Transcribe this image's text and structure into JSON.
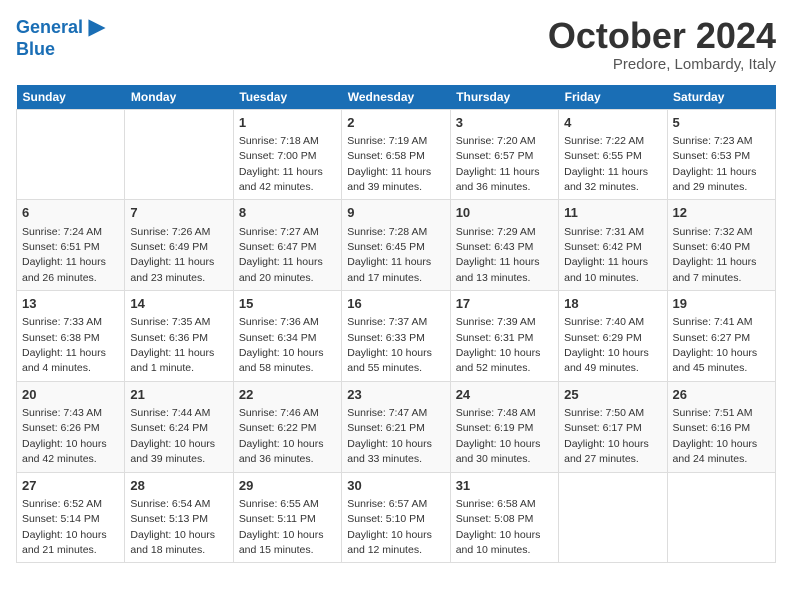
{
  "header": {
    "logo_line1": "General",
    "logo_line2": "Blue",
    "month": "October 2024",
    "location": "Predore, Lombardy, Italy"
  },
  "weekdays": [
    "Sunday",
    "Monday",
    "Tuesday",
    "Wednesday",
    "Thursday",
    "Friday",
    "Saturday"
  ],
  "weeks": [
    [
      {
        "day": "",
        "sunrise": "",
        "sunset": "",
        "daylight": ""
      },
      {
        "day": "",
        "sunrise": "",
        "sunset": "",
        "daylight": ""
      },
      {
        "day": "1",
        "sunrise": "Sunrise: 7:18 AM",
        "sunset": "Sunset: 7:00 PM",
        "daylight": "Daylight: 11 hours and 42 minutes."
      },
      {
        "day": "2",
        "sunrise": "Sunrise: 7:19 AM",
        "sunset": "Sunset: 6:58 PM",
        "daylight": "Daylight: 11 hours and 39 minutes."
      },
      {
        "day": "3",
        "sunrise": "Sunrise: 7:20 AM",
        "sunset": "Sunset: 6:57 PM",
        "daylight": "Daylight: 11 hours and 36 minutes."
      },
      {
        "day": "4",
        "sunrise": "Sunrise: 7:22 AM",
        "sunset": "Sunset: 6:55 PM",
        "daylight": "Daylight: 11 hours and 32 minutes."
      },
      {
        "day": "5",
        "sunrise": "Sunrise: 7:23 AM",
        "sunset": "Sunset: 6:53 PM",
        "daylight": "Daylight: 11 hours and 29 minutes."
      }
    ],
    [
      {
        "day": "6",
        "sunrise": "Sunrise: 7:24 AM",
        "sunset": "Sunset: 6:51 PM",
        "daylight": "Daylight: 11 hours and 26 minutes."
      },
      {
        "day": "7",
        "sunrise": "Sunrise: 7:26 AM",
        "sunset": "Sunset: 6:49 PM",
        "daylight": "Daylight: 11 hours and 23 minutes."
      },
      {
        "day": "8",
        "sunrise": "Sunrise: 7:27 AM",
        "sunset": "Sunset: 6:47 PM",
        "daylight": "Daylight: 11 hours and 20 minutes."
      },
      {
        "day": "9",
        "sunrise": "Sunrise: 7:28 AM",
        "sunset": "Sunset: 6:45 PM",
        "daylight": "Daylight: 11 hours and 17 minutes."
      },
      {
        "day": "10",
        "sunrise": "Sunrise: 7:29 AM",
        "sunset": "Sunset: 6:43 PM",
        "daylight": "Daylight: 11 hours and 13 minutes."
      },
      {
        "day": "11",
        "sunrise": "Sunrise: 7:31 AM",
        "sunset": "Sunset: 6:42 PM",
        "daylight": "Daylight: 11 hours and 10 minutes."
      },
      {
        "day": "12",
        "sunrise": "Sunrise: 7:32 AM",
        "sunset": "Sunset: 6:40 PM",
        "daylight": "Daylight: 11 hours and 7 minutes."
      }
    ],
    [
      {
        "day": "13",
        "sunrise": "Sunrise: 7:33 AM",
        "sunset": "Sunset: 6:38 PM",
        "daylight": "Daylight: 11 hours and 4 minutes."
      },
      {
        "day": "14",
        "sunrise": "Sunrise: 7:35 AM",
        "sunset": "Sunset: 6:36 PM",
        "daylight": "Daylight: 11 hours and 1 minute."
      },
      {
        "day": "15",
        "sunrise": "Sunrise: 7:36 AM",
        "sunset": "Sunset: 6:34 PM",
        "daylight": "Daylight: 10 hours and 58 minutes."
      },
      {
        "day": "16",
        "sunrise": "Sunrise: 7:37 AM",
        "sunset": "Sunset: 6:33 PM",
        "daylight": "Daylight: 10 hours and 55 minutes."
      },
      {
        "day": "17",
        "sunrise": "Sunrise: 7:39 AM",
        "sunset": "Sunset: 6:31 PM",
        "daylight": "Daylight: 10 hours and 52 minutes."
      },
      {
        "day": "18",
        "sunrise": "Sunrise: 7:40 AM",
        "sunset": "Sunset: 6:29 PM",
        "daylight": "Daylight: 10 hours and 49 minutes."
      },
      {
        "day": "19",
        "sunrise": "Sunrise: 7:41 AM",
        "sunset": "Sunset: 6:27 PM",
        "daylight": "Daylight: 10 hours and 45 minutes."
      }
    ],
    [
      {
        "day": "20",
        "sunrise": "Sunrise: 7:43 AM",
        "sunset": "Sunset: 6:26 PM",
        "daylight": "Daylight: 10 hours and 42 minutes."
      },
      {
        "day": "21",
        "sunrise": "Sunrise: 7:44 AM",
        "sunset": "Sunset: 6:24 PM",
        "daylight": "Daylight: 10 hours and 39 minutes."
      },
      {
        "day": "22",
        "sunrise": "Sunrise: 7:46 AM",
        "sunset": "Sunset: 6:22 PM",
        "daylight": "Daylight: 10 hours and 36 minutes."
      },
      {
        "day": "23",
        "sunrise": "Sunrise: 7:47 AM",
        "sunset": "Sunset: 6:21 PM",
        "daylight": "Daylight: 10 hours and 33 minutes."
      },
      {
        "day": "24",
        "sunrise": "Sunrise: 7:48 AM",
        "sunset": "Sunset: 6:19 PM",
        "daylight": "Daylight: 10 hours and 30 minutes."
      },
      {
        "day": "25",
        "sunrise": "Sunrise: 7:50 AM",
        "sunset": "Sunset: 6:17 PM",
        "daylight": "Daylight: 10 hours and 27 minutes."
      },
      {
        "day": "26",
        "sunrise": "Sunrise: 7:51 AM",
        "sunset": "Sunset: 6:16 PM",
        "daylight": "Daylight: 10 hours and 24 minutes."
      }
    ],
    [
      {
        "day": "27",
        "sunrise": "Sunrise: 6:52 AM",
        "sunset": "Sunset: 5:14 PM",
        "daylight": "Daylight: 10 hours and 21 minutes."
      },
      {
        "day": "28",
        "sunrise": "Sunrise: 6:54 AM",
        "sunset": "Sunset: 5:13 PM",
        "daylight": "Daylight: 10 hours and 18 minutes."
      },
      {
        "day": "29",
        "sunrise": "Sunrise: 6:55 AM",
        "sunset": "Sunset: 5:11 PM",
        "daylight": "Daylight: 10 hours and 15 minutes."
      },
      {
        "day": "30",
        "sunrise": "Sunrise: 6:57 AM",
        "sunset": "Sunset: 5:10 PM",
        "daylight": "Daylight: 10 hours and 12 minutes."
      },
      {
        "day": "31",
        "sunrise": "Sunrise: 6:58 AM",
        "sunset": "Sunset: 5:08 PM",
        "daylight": "Daylight: 10 hours and 10 minutes."
      },
      {
        "day": "",
        "sunrise": "",
        "sunset": "",
        "daylight": ""
      },
      {
        "day": "",
        "sunrise": "",
        "sunset": "",
        "daylight": ""
      }
    ]
  ]
}
